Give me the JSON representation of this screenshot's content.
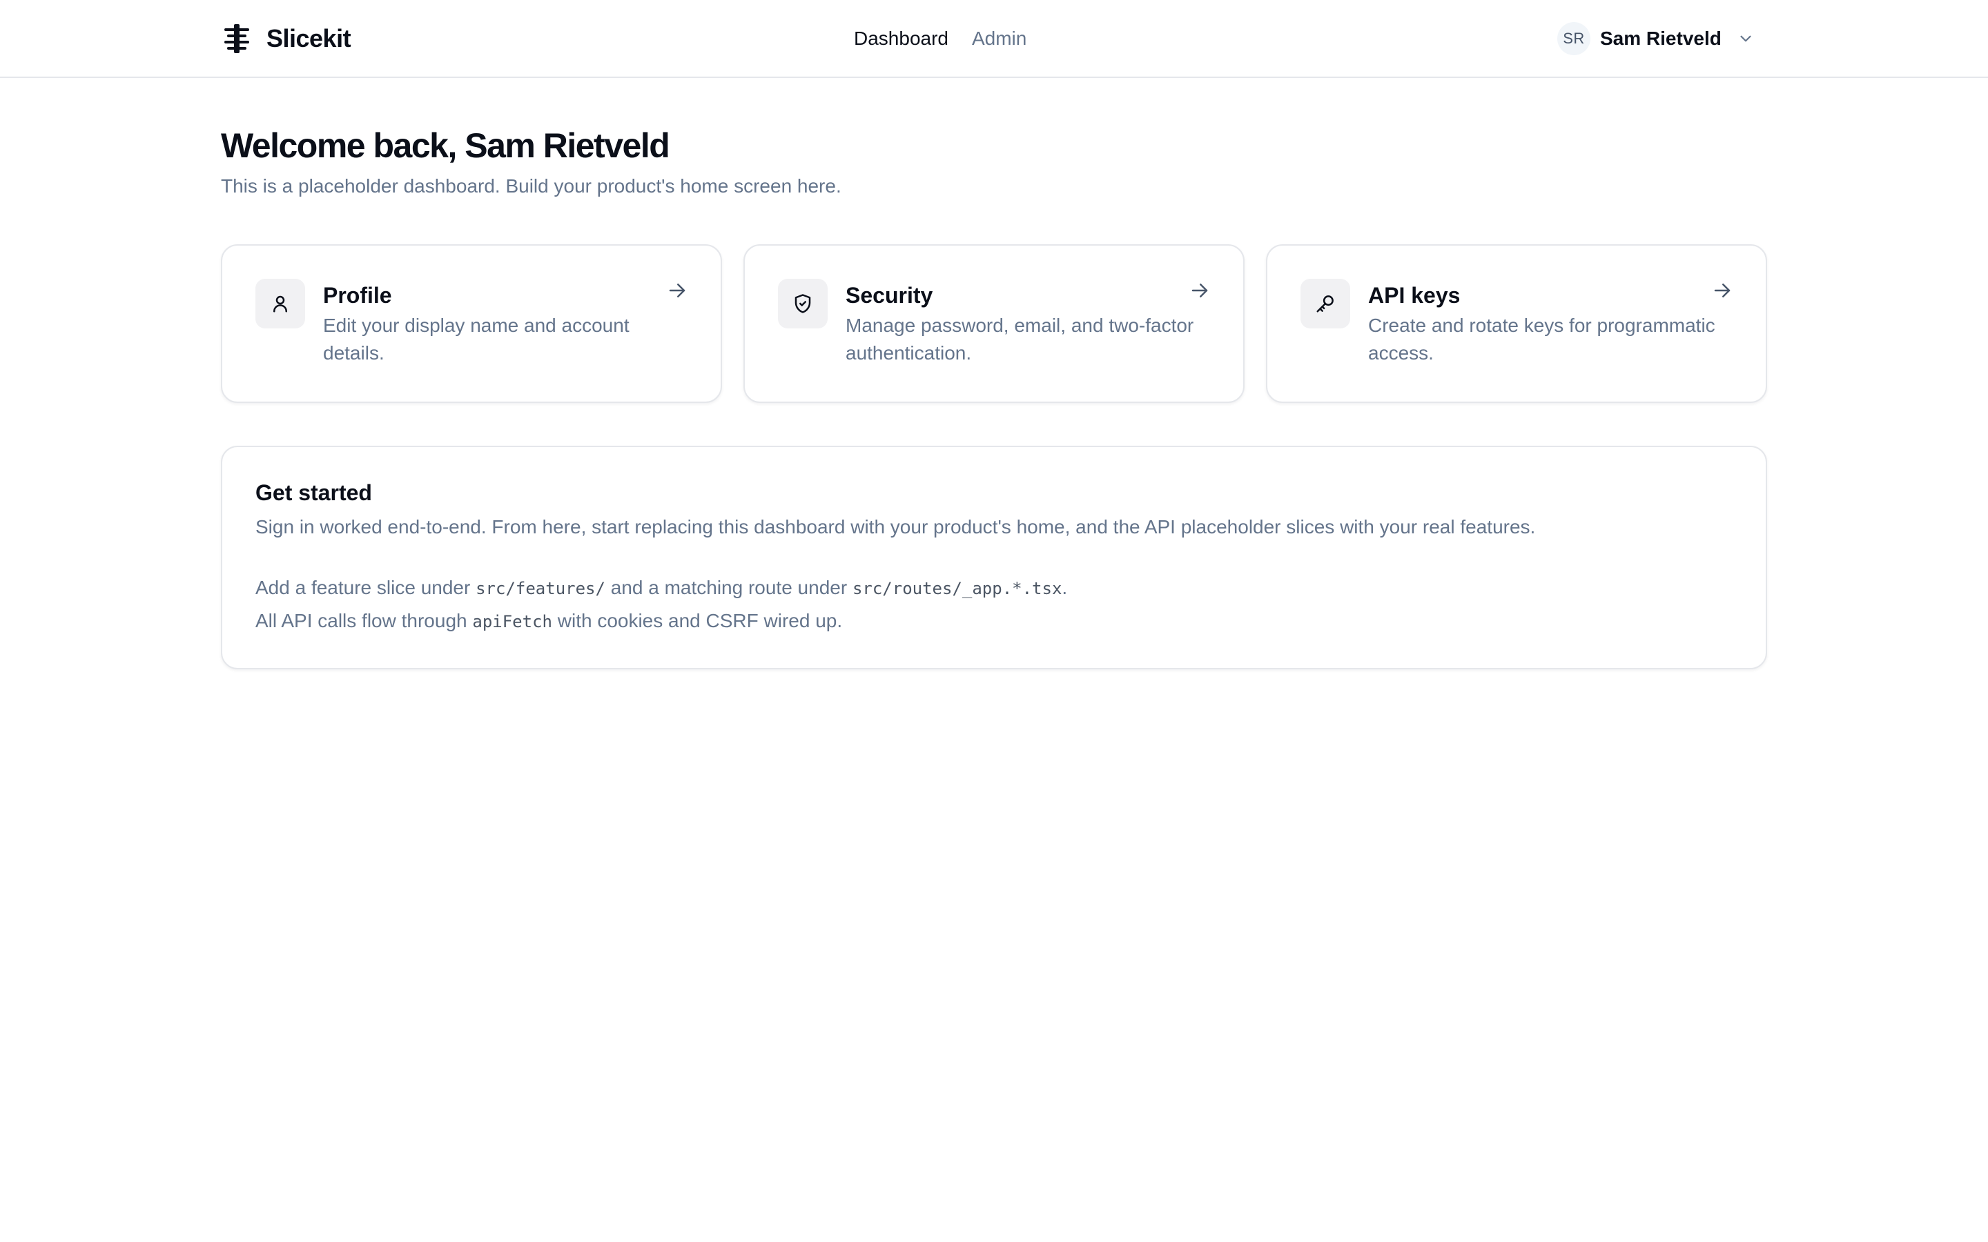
{
  "brand": {
    "name": "Slicekit",
    "logo_icon": "slicekit-logo-icon"
  },
  "nav": {
    "items": [
      {
        "label": "Dashboard",
        "active": true
      },
      {
        "label": "Admin",
        "active": false
      }
    ]
  },
  "user": {
    "initials": "SR",
    "name": "Sam Rietveld",
    "menu_icon": "chevron-down-icon"
  },
  "main": {
    "title": "Welcome back, Sam Rietveld",
    "subtitle": "This is a placeholder dashboard. Build your product's home screen here.",
    "cards": [
      {
        "icon": "user-icon",
        "title": "Profile",
        "description": "Edit your display name and account details.",
        "action_icon": "arrow-right-icon"
      },
      {
        "icon": "shield-check-icon",
        "title": "Security",
        "description": "Manage password, email, and two-factor authentication.",
        "action_icon": "arrow-right-icon"
      },
      {
        "icon": "key-icon",
        "title": "API keys",
        "description": "Create and rotate keys for programmatic access.",
        "action_icon": "arrow-right-icon"
      }
    ],
    "get_started": {
      "title": "Get started",
      "intro": "Sign in worked end-to-end. From here, start replacing this dashboard with your product's home, and the API placeholder slices with your real features.",
      "line2": {
        "text_1": "Add a feature slice under ",
        "code_1": "src/features/",
        "text_2": " and a matching route under ",
        "code_2": "src/routes/_app.*.tsx",
        "text_3": "."
      },
      "line3": {
        "text_1": "All API calls flow through ",
        "code_1": "apiFetch",
        "text_2": " with cookies and CSRF wired up."
      }
    }
  },
  "colors": {
    "text_primary": "#0b0f19",
    "text_muted": "#64748b",
    "border": "#e5e7eb",
    "icon_tile": "#f1f1f3",
    "avatar_bg": "#f1f5f9"
  }
}
